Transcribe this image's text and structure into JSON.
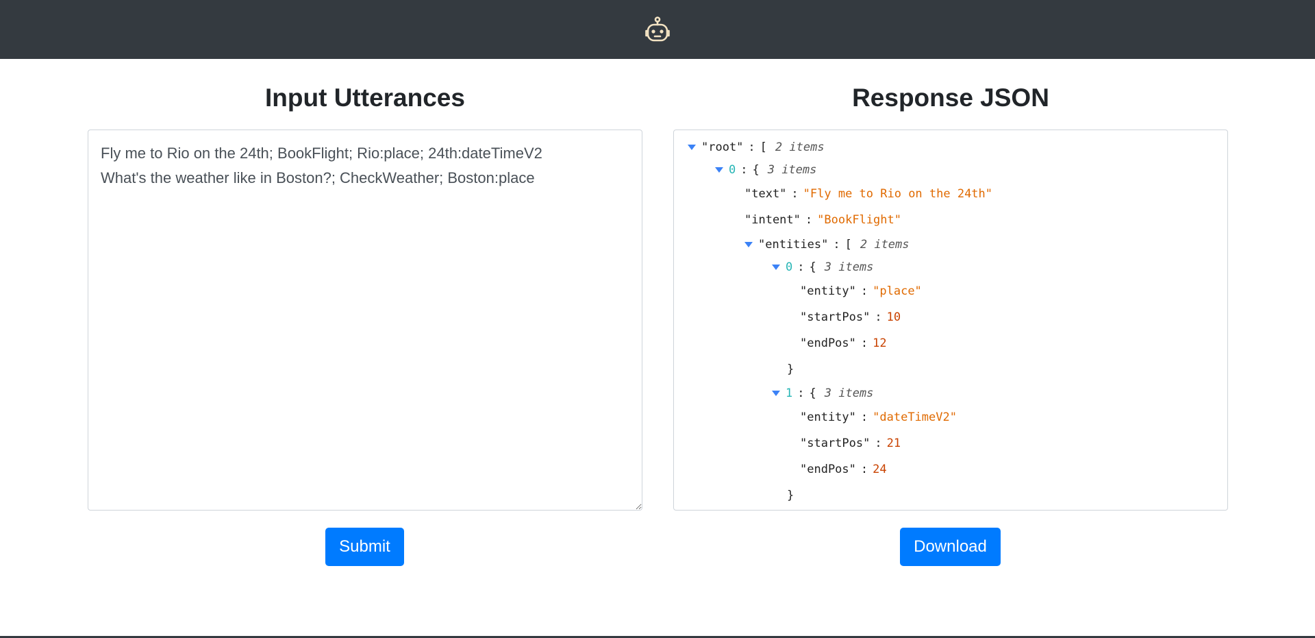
{
  "header": {
    "logo_icon": "robot-icon",
    "background": "#343a40",
    "icon_color": "#f3e3c3"
  },
  "input": {
    "heading": "Input Utterances",
    "text": "Fly me to Rio on the 24th; BookFlight; Rio:place; 24th:dateTimeV2\nWhat's the weather like in Boston?; CheckWeather; Boston:place"
  },
  "submit_label": "Submit",
  "response": {
    "heading": "Response JSON",
    "root_key": "\"root\"",
    "root_open": "[",
    "root_count": "2 items",
    "item0": {
      "index": "0",
      "open": "{",
      "count": "3 items",
      "text_key": "\"text\"",
      "text_value": "\"Fly me to Rio on the 24th\"",
      "intent_key": "\"intent\"",
      "intent_value": "\"BookFlight\"",
      "entities_key": "\"entities\"",
      "entities_open": "[",
      "entities_count": "2 items",
      "entities": [
        {
          "index": "0",
          "open": "{",
          "count": "3 items",
          "entity_key": "\"entity\"",
          "entity_value": "\"place\"",
          "start_key": "\"startPos\"",
          "start_value": "10",
          "end_key": "\"endPos\"",
          "end_value": "12",
          "close": "}"
        },
        {
          "index": "1",
          "open": "{",
          "count": "3 items",
          "entity_key": "\"entity\"",
          "entity_value": "\"dateTimeV2\"",
          "start_key": "\"startPos\"",
          "start_value": "21",
          "end_key": "\"endPos\"",
          "end_value": "24",
          "close": "}"
        }
      ],
      "entities_close": "]"
    }
  },
  "download_label": "Download",
  "colors": {
    "primary_button": "#007bff",
    "string": "#e06a00",
    "number": "#c94200",
    "index": "#26b5b5",
    "caret": "#3b82f6"
  }
}
